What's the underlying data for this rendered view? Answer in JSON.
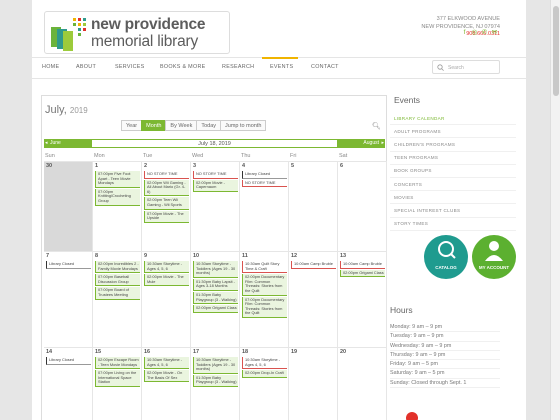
{
  "header": {
    "logo_line1": "new providence",
    "logo_line2": "memorial library",
    "address_line1": "377 ELKWOOD AVENUE",
    "address_line2": "NEW PROVIDENCE, NJ 07974",
    "phone": "908.665.0311",
    "social": [
      "facebook-icon",
      "instagram-icon",
      "phone-icon",
      "email-icon"
    ]
  },
  "nav": {
    "items": [
      "HOME",
      "ABOUT",
      "SERVICES",
      "BOOKS & MORE",
      "RESEARCH",
      "EVENTS",
      "CONTACT"
    ],
    "active": "EVENTS",
    "search_placeholder": "Search"
  },
  "calendar": {
    "month": "July,",
    "year": "2019",
    "views": [
      "Year",
      "Month",
      "By Week",
      "Today",
      "Jump to month"
    ],
    "active_view": "Month",
    "prev_label": "June",
    "current_label": "July 18, 2019",
    "next_label": "August",
    "dow": [
      "Sun",
      "Mon",
      "Tue",
      "Wed",
      "Thu",
      "Fri",
      "Sat"
    ],
    "weeks": [
      {
        "days": [
          {
            "n": "30",
            "past": true,
            "events": []
          },
          {
            "n": "1",
            "past": false,
            "events": [
              {
                "t": "07:00pm Five Foot Apart - Teen Movie Mondays",
                "c": "g"
              },
              {
                "t": "07:00pm Knitting/Crocheting Group",
                "c": "g"
              }
            ]
          },
          {
            "n": "2",
            "past": false,
            "events": [
              {
                "t": "NO STORY TIME",
                "c": "r"
              },
              {
                "t": "02:00pm Wii Gaming - All About Mario (Gr. 4-6)",
                "c": "g"
              },
              {
                "t": "02:00pm Teen Wii Gaming - Wii Sports",
                "c": "g"
              },
              {
                "t": "07:00pm Movie - The Upside",
                "c": "g"
              }
            ]
          },
          {
            "n": "3",
            "past": false,
            "events": [
              {
                "t": "NO STORY TIME",
                "c": "r"
              },
              {
                "t": "02:00pm Movie - Capernaum",
                "c": "g"
              }
            ]
          },
          {
            "n": "4",
            "past": false,
            "events": [
              {
                "t": "Library Closed",
                "c": "k"
              },
              {
                "t": "NO STORY TIME",
                "c": "r"
              }
            ]
          },
          {
            "n": "5",
            "past": false,
            "events": []
          },
          {
            "n": "6",
            "past": false,
            "events": []
          }
        ]
      },
      {
        "days": [
          {
            "n": "7",
            "past": false,
            "events": [
              {
                "t": "Library Closed",
                "c": "k"
              }
            ]
          },
          {
            "n": "8",
            "past": false,
            "events": [
              {
                "t": "02:00pm Incredibles 2 - Family Movie Mondays",
                "c": "g"
              },
              {
                "t": "07:00pm Baseball Discussion Group",
                "c": "g"
              },
              {
                "t": "07:00pm Board of Trustees Meeting",
                "c": "g"
              }
            ]
          },
          {
            "n": "9",
            "past": false,
            "events": [
              {
                "t": "10:30am Storytime - Ages 4, 5, 6",
                "c": "g"
              },
              {
                "t": "02:00pm Movie - The Mule",
                "c": "g"
              }
            ]
          },
          {
            "n": "10",
            "past": false,
            "events": [
              {
                "t": "10:30am Storytime - Toddlers (Ages 19 - 30 months)",
                "c": "g"
              },
              {
                "t": "01:30pm Baby Lapsit - Ages 3-18 Months",
                "c": "g"
              },
              {
                "t": "01:30pm Baby Playgroup (3 - Walking)",
                "c": "g"
              },
              {
                "t": "02:00pm Origami Class",
                "c": "g"
              }
            ]
          },
          {
            "n": "11",
            "past": false,
            "events": [
              {
                "t": "10:30am Quilt Story Time & Craft",
                "c": "r"
              },
              {
                "t": "02:00pm Documentary Film: Common Threads: Stories from the Quilt",
                "c": "g"
              },
              {
                "t": "07:00pm Documentary Film: Common Threads: Stories from the Quilt",
                "c": "g"
              }
            ]
          },
          {
            "n": "12",
            "past": false,
            "events": [
              {
                "t": "10:00am Camp Bruble",
                "c": "r"
              }
            ]
          },
          {
            "n": "13",
            "past": false,
            "events": [
              {
                "t": "10:00am Camp Bruble",
                "c": "r"
              },
              {
                "t": "02:00pm Origami Class",
                "c": "g"
              }
            ]
          }
        ]
      },
      {
        "days": [
          {
            "n": "14",
            "past": false,
            "events": [
              {
                "t": "Library Closed",
                "c": "k"
              }
            ]
          },
          {
            "n": "15",
            "past": false,
            "events": [
              {
                "t": "02:00pm Escape Room - Teen Movie Mondays",
                "c": "g"
              },
              {
                "t": "07:00pm Living on the International Space Station",
                "c": "g"
              }
            ]
          },
          {
            "n": "16",
            "past": false,
            "events": [
              {
                "t": "10:30am Storytime - Ages 4, 5, 6",
                "c": "g"
              },
              {
                "t": "02:00pm Movie - On The Basis Of Sex",
                "c": "g"
              }
            ]
          },
          {
            "n": "17",
            "past": false,
            "events": [
              {
                "t": "10:30am Storytime - Toddlers (Ages 19 - 30 months)",
                "c": "g"
              },
              {
                "t": "01:30pm Baby Playgroup (3 - Walking)",
                "c": "g"
              }
            ]
          },
          {
            "n": "18",
            "past": false,
            "events": [
              {
                "t": "10:30am Storytime - Ages 4, 5, 6",
                "c": "r"
              },
              {
                "t": "02:00pm Drop-In Craft",
                "c": "g"
              }
            ]
          },
          {
            "n": "19",
            "past": false,
            "events": []
          },
          {
            "n": "20",
            "past": false,
            "events": []
          }
        ]
      }
    ]
  },
  "sidebar": {
    "events_title": "Events",
    "links": [
      "LIBRARY CALENDAR",
      "ADULT PROGRAMS",
      "CHILDREN'S PROGRAMS",
      "TEEN PROGRAMS",
      "BOOK GROUPS",
      "CONCERTS",
      "MOVIES",
      "SPECIAL INTEREST CLUBS",
      "STORY TIMES"
    ],
    "active_link": "LIBRARY CALENDAR",
    "catalog_label": "CATALOG",
    "account_label": "MY ACCOUNT",
    "hours_title": "Hours",
    "hours": [
      "Monday: 9 am – 9 pm",
      "Tuesday: 9 am – 9 pm",
      "Wednesday: 9 am – 9 pm",
      "Thursday: 9 am – 9 pm",
      "Friday: 9 am – 5 pm",
      "Saturday: 9 am – 5 pm",
      "Sunday: Closed through Sept. 1"
    ]
  },
  "colors": {
    "accent": "#7cb832",
    "alert": "#e2312a",
    "teal": "#1f9b8f",
    "nav_active": "#f0b400"
  }
}
